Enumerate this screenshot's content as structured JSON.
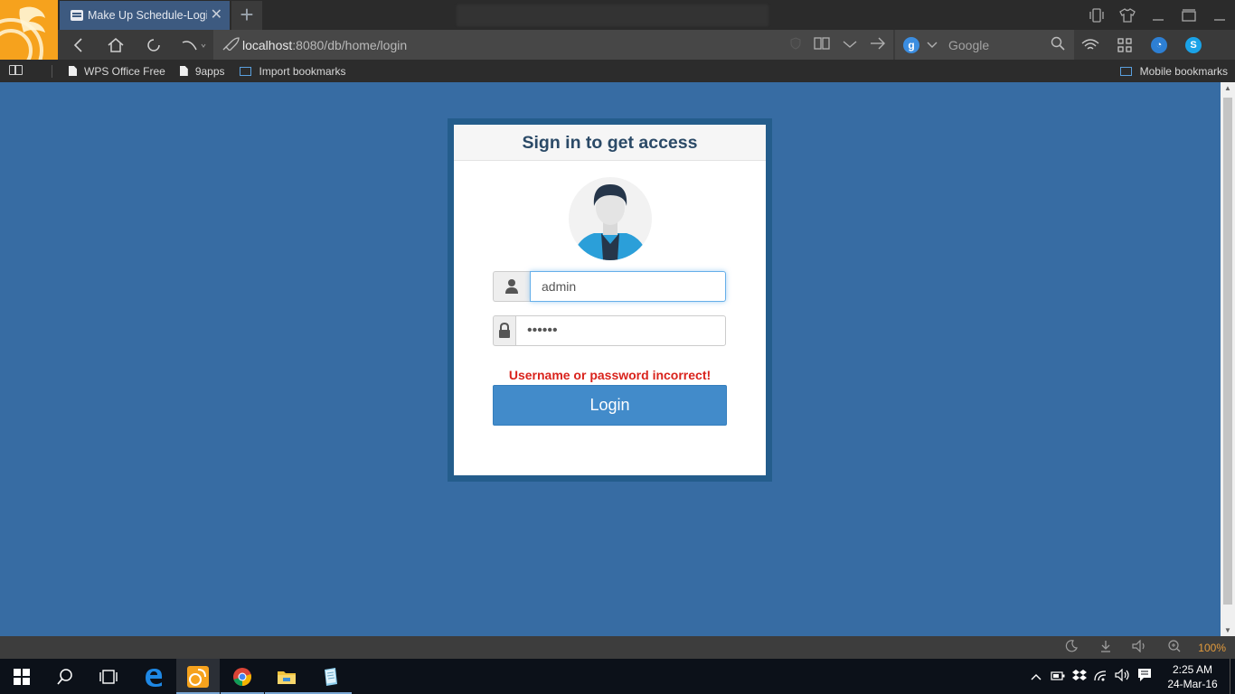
{
  "browser": {
    "tab_title": "Make Up Schedule-Login",
    "tab_close": "✕",
    "newtab": "+",
    "url_host": "localhost",
    "url_rest": ":8080/db/home/login",
    "search_engine_letter": "g",
    "search_placeholder": "Google",
    "icons": [
      "back-icon",
      "home-icon",
      "reload-icon",
      "undo-icon",
      "rocket-icon",
      "reader-icon",
      "dropdown-icon",
      "go-icon",
      "search-icon",
      "wifi-icon",
      "grid-icon",
      "vpn-icon",
      "skype-icon"
    ],
    "bookmarks": [
      {
        "label": "WPS Office Free",
        "icon": "doc-icon"
      },
      {
        "label": "9apps",
        "icon": "doc-icon"
      },
      {
        "label": "Import bookmarks",
        "icon": "import-icon"
      }
    ],
    "mobile_bookmarks": "Mobile bookmarks",
    "zoom": "100%"
  },
  "login": {
    "title": "Sign in to get access",
    "username_value": "admin",
    "password_value": "••••••",
    "error": "Username or password incorrect!",
    "button": "Login"
  },
  "taskbar": {
    "time": "2:25 AM",
    "date": "24-Mar-16",
    "apps": [
      "start-icon",
      "search-icon",
      "task-view-icon",
      "edge-icon",
      "uc-browser-icon",
      "chrome-icon",
      "file-explorer-icon",
      "notepad-icon"
    ]
  },
  "colors": {
    "page_bg": "#376ca3",
    "panel_border": "#245d8c",
    "button": "#428bca",
    "error": "#d9231c",
    "uc_orange": "#f6a21d"
  }
}
